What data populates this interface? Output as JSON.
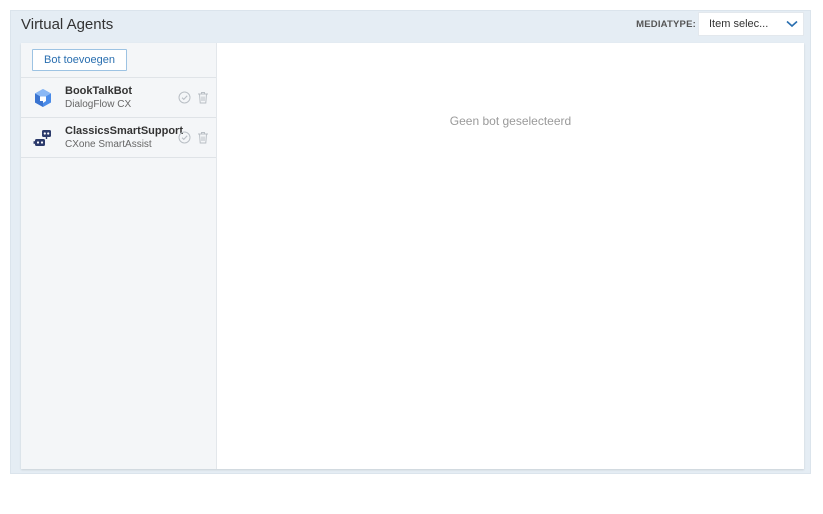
{
  "header": {
    "title": "Virtual Agents",
    "mediatype_label": "MEDIATYPE:",
    "mediatype_value": "Item selec..."
  },
  "sidebar": {
    "add_button_label": "Bot toevoegen",
    "bots": [
      {
        "name": "BookTalkBot",
        "type": "DialogFlow CX",
        "icon": "dialogflow-cx-icon"
      },
      {
        "name": "ClassicsSmartSupport",
        "type": "CXone SmartAssist",
        "icon": "robot-icon"
      }
    ]
  },
  "main": {
    "empty_message": "Geen bot geselecteerd"
  },
  "colors": {
    "frame_bg": "#e5edf4",
    "accent": "#2a6fb0",
    "dialogflow_blue": "#4a8be8",
    "robot_navy": "#2b3a6b"
  }
}
